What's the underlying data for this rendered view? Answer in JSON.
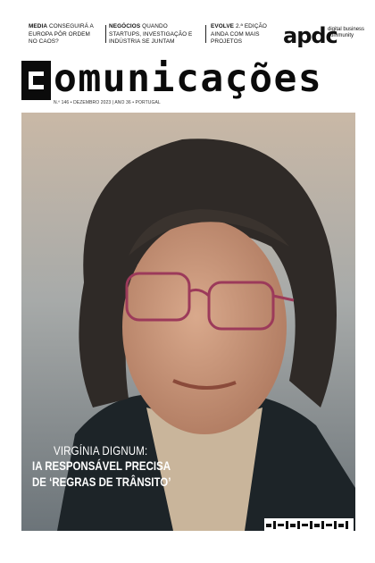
{
  "teasers": [
    {
      "section": "MEDIA",
      "text": "CONSEGUIRÁ A EUROPA PÔR ORDEM NO CAOS?"
    },
    {
      "section": "NEGÓCIOS",
      "text": "QUANDO STARTUPS, INVESTIGAÇÃO E INDÚSTRIA SE JUNTAM"
    },
    {
      "section": "EVOLVE",
      "text": "2.ª EDIÇÃO AINDA COM MAIS PROJETOS"
    }
  ],
  "brand": {
    "logo": "apdc",
    "tagline": "digital business community"
  },
  "masthead": {
    "title": "omunicações",
    "issue_line": "N.º 146 • DEZEMBRO 2023 | ANO 36 • PORTUGAL"
  },
  "cover": {
    "headline_name": "VIRGÍNIA DIGNUM:",
    "headline_line2": "IA RESPONSÁVEL PRECISA",
    "headline_line3": "DE ‘REGRAS DE TRÂNSITO’"
  },
  "colors": {
    "masthead": "#0b0b0b",
    "headline": "#ffffff"
  }
}
